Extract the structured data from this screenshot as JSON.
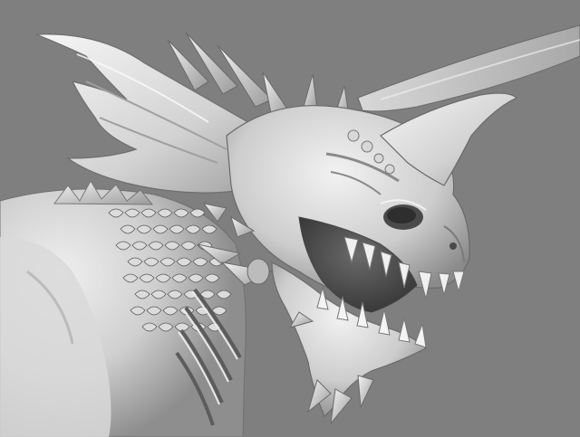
{
  "viewport": {
    "background_color": "#7f7f7f",
    "render_style": "matcap-clay",
    "subject": "dragon-head-sculpt"
  },
  "palette": {
    "highlight": "#f4f4f4",
    "light": "#dcdcdc",
    "mid": "#bdbdbd",
    "shade": "#9a9a9a",
    "dark": "#5c5c5c",
    "cavity": "#3a3a3a"
  }
}
